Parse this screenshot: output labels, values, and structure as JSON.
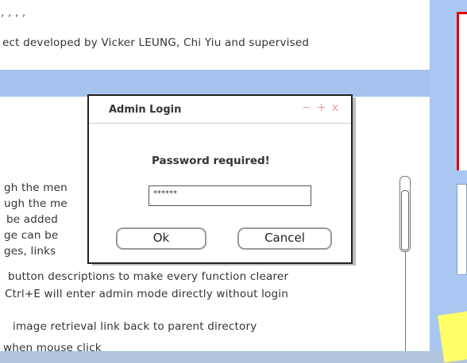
{
  "page": {
    "lines_top": [
      "ect developed by Vicker LEUNG, Chi Yiu and supervised"
    ],
    "lines": [
      "gh the men",
      "ugh the me",
      "be added",
      "ge can be",
      "ges, links",
      "button descriptions to make every function clearer",
      "Ctrl+E will enter admin mode directly without login",
      "image retrieval link back to parent directory",
      "when mouse click"
    ]
  },
  "dialog": {
    "title": "Admin Login",
    "controls": [
      "−",
      "+",
      "x"
    ],
    "prompt": "Password required!",
    "password_value": "******",
    "ok_label": "Ok",
    "cancel_label": "Cancel"
  },
  "scrollbar": {
    "up_icon": "⇧"
  },
  "colors": {
    "page_background": "#a9c3e6",
    "red_accent": "#e00000",
    "sticky_note": "#ffff66"
  }
}
